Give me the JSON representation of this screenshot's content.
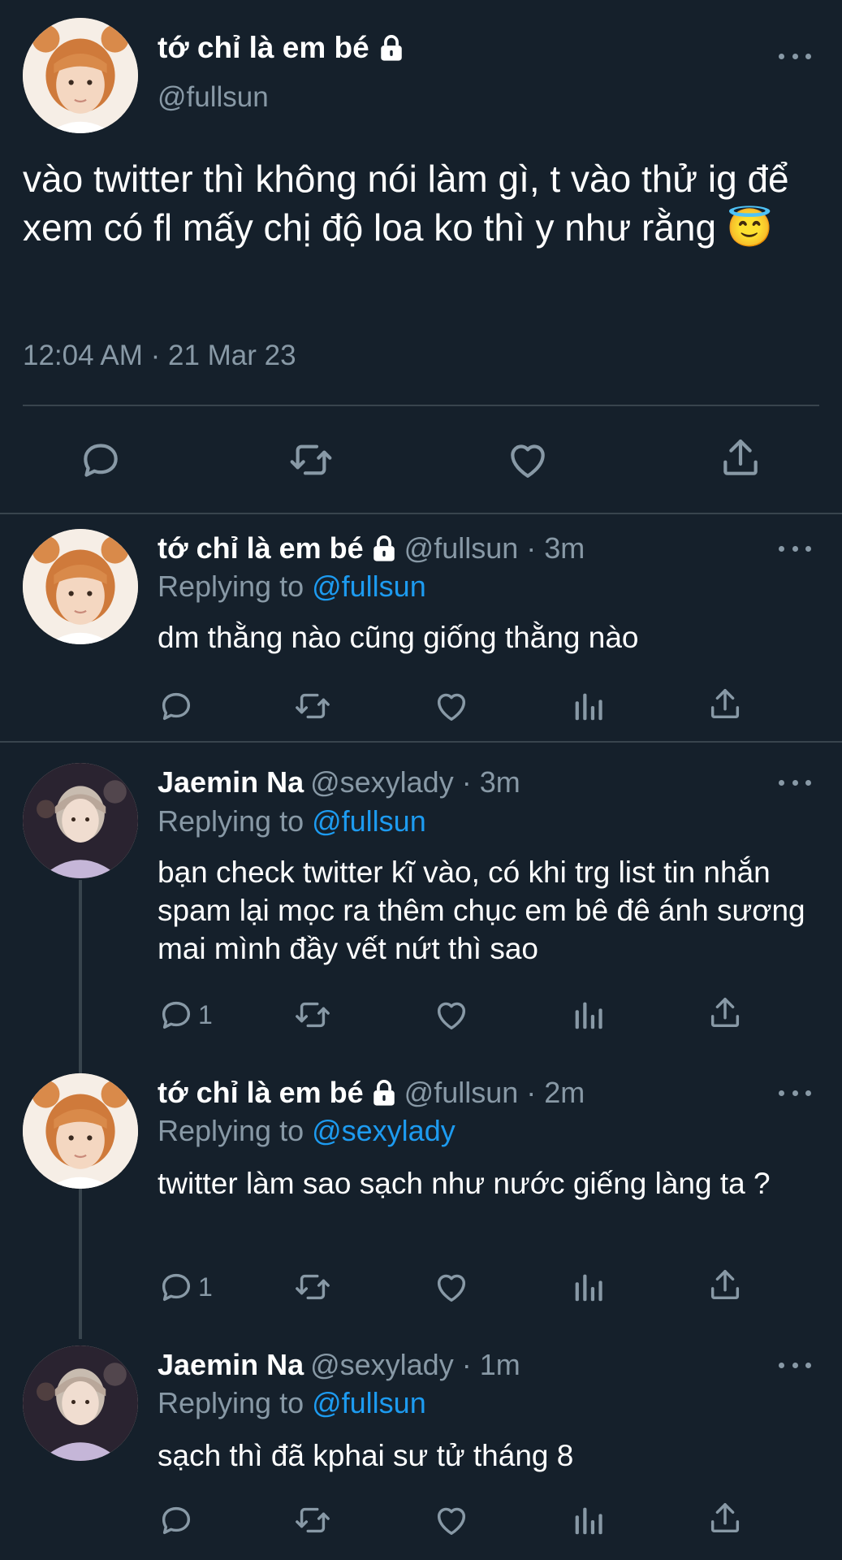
{
  "main_tweet": {
    "name": "tớ chỉ là em bé",
    "handle": "@fullsun",
    "text": "vào twitter thì không nói làm gì, t vào thử ig để xem có fl mấy chị độ loa ko thì y như rằng 😇",
    "timestamp": "12:04 AM · 21 Mar 23"
  },
  "replies": [
    {
      "name": "tớ chỉ là em bé",
      "meta": "@fullsun · 3m",
      "replying_prefix": "Replying to ",
      "replying_to": "@fullsun",
      "text": "dm thằng nào cũng giống thằng nào",
      "reply_count": ""
    },
    {
      "name": "Jaemin Na",
      "meta": "@sexylady · 3m",
      "replying_prefix": "Replying to ",
      "replying_to": "@fullsun",
      "text": "bạn check twitter kĩ vào, có khi trg list tin nhắn spam lại mọc ra thêm chục em bê đê ánh sương mai mình đầy vết nứt thì sao",
      "reply_count": "1"
    },
    {
      "name": "tớ chỉ là em bé",
      "meta": "@fullsun · 2m",
      "replying_prefix": "Replying to ",
      "replying_to": "@sexylady",
      "text": "twitter làm sao sạch như nước giếng làng ta ?",
      "reply_count": "1"
    },
    {
      "name": "Jaemin Na",
      "meta": "@sexylady · 1m",
      "replying_prefix": "Replying to ",
      "replying_to": "@fullsun",
      "text": "sạch thì đã kphai sư tử tháng 8",
      "reply_count": ""
    }
  ],
  "colors": {
    "background": "#15202b",
    "text": "#ffffff",
    "secondary": "#8899a6",
    "link": "#1d9bf0",
    "border": "#38444d"
  },
  "icons": [
    "lock-icon",
    "more-icon",
    "reply-icon",
    "retweet-icon",
    "like-icon",
    "analytics-icon",
    "share-icon"
  ]
}
